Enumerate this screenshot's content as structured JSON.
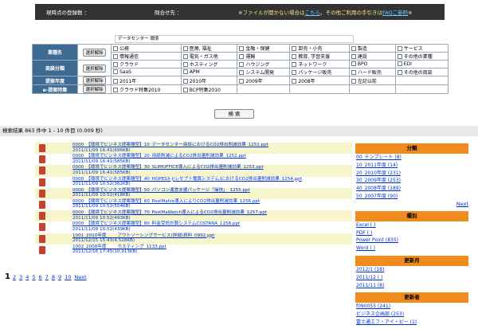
{
  "topbar": {
    "count_label": "現時点の登録数 ：",
    "contact_label": "問合せ先 ：",
    "notice_prefix": "※ファイルが開かない場合は",
    "notice_link": "こちら",
    "notice_mid": "。その他ご利用の手引きは",
    "notice_link2": "FAQご参照",
    "notice_suffix": "※"
  },
  "keyword": "データセンター 環境",
  "filters": {
    "select_label": "選択解除",
    "rows": [
      {
        "label": "業種名",
        "options": [
          [
            "公務",
            "医療, 福祉",
            "金融・保健",
            "卸売・小売",
            "製造",
            "サービス"
          ],
          [
            "情報通信",
            "電気・ガス他",
            "運輸",
            "教育, 学習支援",
            "建設",
            "その他の業種"
          ]
        ]
      },
      {
        "label": "商談分類",
        "options": [
          [
            "クラウド",
            "ホスティング",
            "ハウジング",
            "ネットワーク",
            "BPO",
            "EDI"
          ],
          [
            "SaaS",
            "APM",
            "システム開発",
            "パッケージ販売",
            "ハード販売",
            "その他の商談"
          ]
        ]
      },
      {
        "label": "提案年度",
        "options": [
          [
            "2011年",
            "2010年",
            "2009年",
            "2008年",
            "左記以前",
            ""
          ]
        ]
      },
      {
        "label": "e-提案特集",
        "options": [
          [
            "クラウド特集2010",
            "BCP特集2010",
            "",
            "",
            "",
            ""
          ]
        ]
      }
    ]
  },
  "search_button": "検 索",
  "result_summary": "検索結果 863 件中 1 - 10 件目 (0.009 秒)",
  "results": [
    {
      "title": "0000_【環境でビジネス提案雛型】10_データセンター商談におけるCO2排出削減効果_1251.ppt",
      "meta": "2011/11/09 16:41(696KB)"
    },
    {
      "title": "0000_【環境でビジネス提案雛型】20_用紙削減によるCO2排出量削減効果_1252.ppt",
      "meta": "2011/11/09 16:41(585KB)"
    },
    {
      "title": "0000_【環境でビジネス提案雛型】30_SLIMOFFICE導入によるCO2排出量削減効果_1253.ppt",
      "meta": "2011/11/09 16:41(585KB)"
    },
    {
      "title": "0000_【環境でビジネス提案雛型】40_HOPESX-J(レセプト電算システム)におけるCO2排出量削減効果_1254.ppt",
      "meta": "2011/11/09 10:52(362KB)"
    },
    {
      "title": "0000_【環境でビジネス提案雛型】50_パソコン運営支援パッケージ「操快」_1255.ppt",
      "meta": "2011/11/09 10:52(418KB)"
    },
    {
      "title": "0000_【環境でビジネス提案雛型】60_PostMahle導入によりCO2排出量削減効果_1256.ppt",
      "meta": "2011/11/09 10:52(554KB)"
    },
    {
      "title": "0000_【環境でビジネス提案雛型】70_PostMaWatch導入によるCO2排出量削減効果_1257.ppt",
      "meta": "2011/11/09 10:52(493KB)"
    },
    {
      "title": "0000_【環境でビジネス提案雛型】80_料金受託計算システムCOSTANA_1258.ppt",
      "meta": "2011/11/09 10:52(439KB)"
    },
    {
      "title": "1001_2010年度_　　アウトソーシングサービス(詳細)資料_0992.ppt",
      "meta": "2011/12/15 15:43(4,528KB)"
    },
    {
      "title": "1002_2008年度_　　ホスティング_1133.ppt",
      "meta": "2011/12/16 17:45(10,913KB)"
    }
  ],
  "pager": {
    "current": "1",
    "pages": [
      "2",
      "3",
      "4",
      "5",
      "6",
      "7",
      "8",
      "9",
      "10"
    ],
    "next": "Next"
  },
  "side": {
    "category": {
      "title": "分類",
      "items": [
        "00_テンプレート (8)",
        "10_2011年度 (14)",
        "20_2010年度 (231)",
        "30_2009年度 (253)",
        "40_2008年度 (189)",
        "50_2007年度 (90)"
      ],
      "next": "Next"
    },
    "kind": {
      "title": "種別",
      "items": [
        "Excel (  )",
        "PDF (  )",
        "Power Point (835)",
        "Word (  )"
      ]
    },
    "updated": {
      "title": "更新月",
      "items": [
        "2012/1 (18)",
        "2011/12 (  )",
        "2011/11 (8)"
      ]
    },
    "updater": {
      "title": "更新者",
      "items": [
        "f090055 (241)",
        "ビジネス企画部 (253)",
        "富士通エフ・アイ・ピー (1)"
      ]
    }
  }
}
